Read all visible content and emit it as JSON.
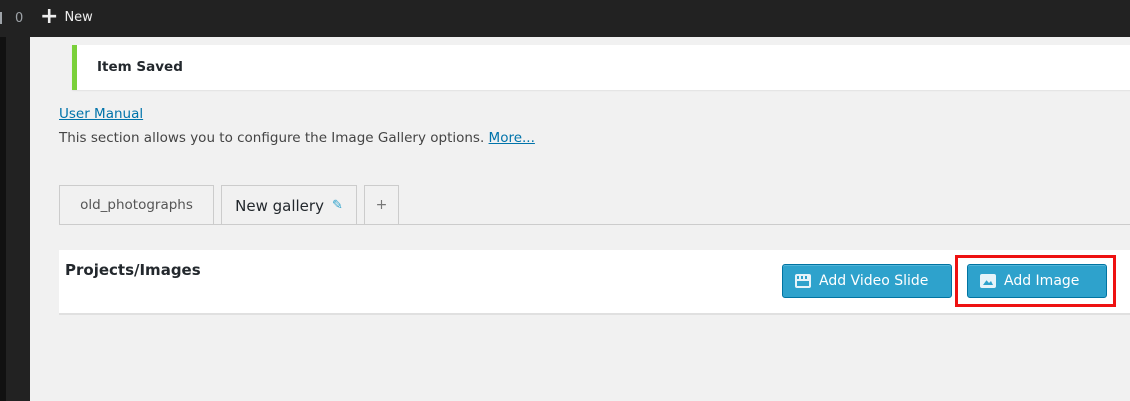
{
  "adminbar": {
    "count": "0",
    "new_label": "New"
  },
  "notice": {
    "text": "Item Saved"
  },
  "intro": {
    "manual_link": "User Manual",
    "description": "This section allows you to configure the Image Gallery options.",
    "more_link": "More..."
  },
  "tabs": [
    {
      "label": "old_photographs"
    },
    {
      "label": "New gallery"
    },
    {
      "label": "+"
    }
  ],
  "panel": {
    "title": "Projects/Images",
    "add_video_label": "Add Video Slide",
    "add_image_label": "Add Image"
  },
  "colors": {
    "accent": "#2ea2cc",
    "notice_border": "#7ad03a",
    "highlight": "#ee1111"
  }
}
